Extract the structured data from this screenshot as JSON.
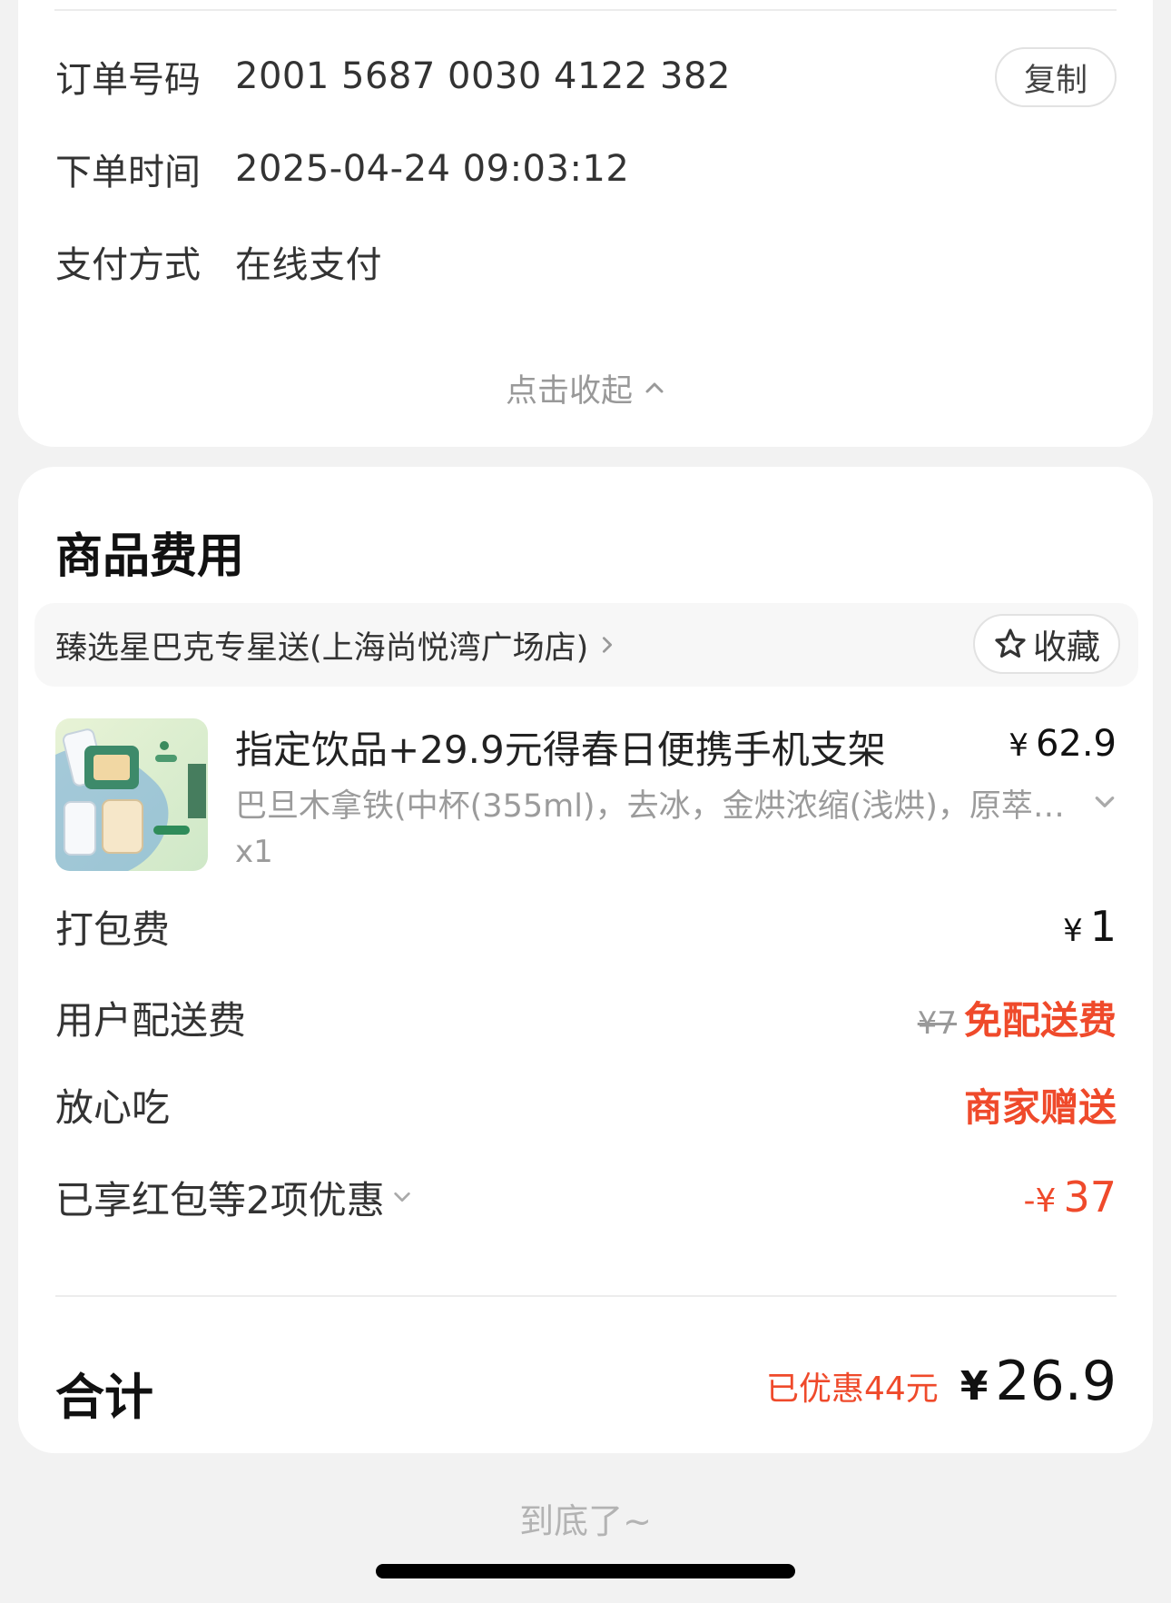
{
  "order_info": {
    "rows": [
      {
        "label": "订单号码",
        "value": "2001 5687 0030 4122 382"
      },
      {
        "label": "下单时间",
        "value": "2025-04-24 09:03:12"
      },
      {
        "label": "支付方式",
        "value": "在线支付"
      }
    ],
    "copy_label": "复制",
    "collapse_label": "点击收起"
  },
  "cost": {
    "title": "商品费用",
    "store_name": "臻选星巴克专星送(上海尚悦湾广场店)",
    "favorite_label": "收藏",
    "product": {
      "title": "指定饮品+29.9元得春日便携手机支架",
      "currency": "¥",
      "price": "62.9",
      "desc": "巴旦木拿铁(中杯(355ml)，去冰，金烘浓缩(浅烘)，原萃…",
      "qty": "x1"
    },
    "fees": {
      "packing_label": "打包费",
      "packing_currency": "¥",
      "packing_value": "1",
      "delivery_label": "用户配送费",
      "delivery_original": "¥7",
      "delivery_value": "免配送费",
      "assurance_label": "放心吃",
      "assurance_value": "商家赠送",
      "discount_label": "已享红包等2项优惠",
      "discount_prefix": "-¥",
      "discount_value": "37"
    },
    "total": {
      "label": "合计",
      "saved": "已优惠44元",
      "currency": "¥",
      "value": "26.9"
    }
  },
  "footer": {
    "end_text": "到底了~"
  },
  "colors": {
    "accent_red": "#ef4a2b",
    "background": "#f2f2f2"
  }
}
